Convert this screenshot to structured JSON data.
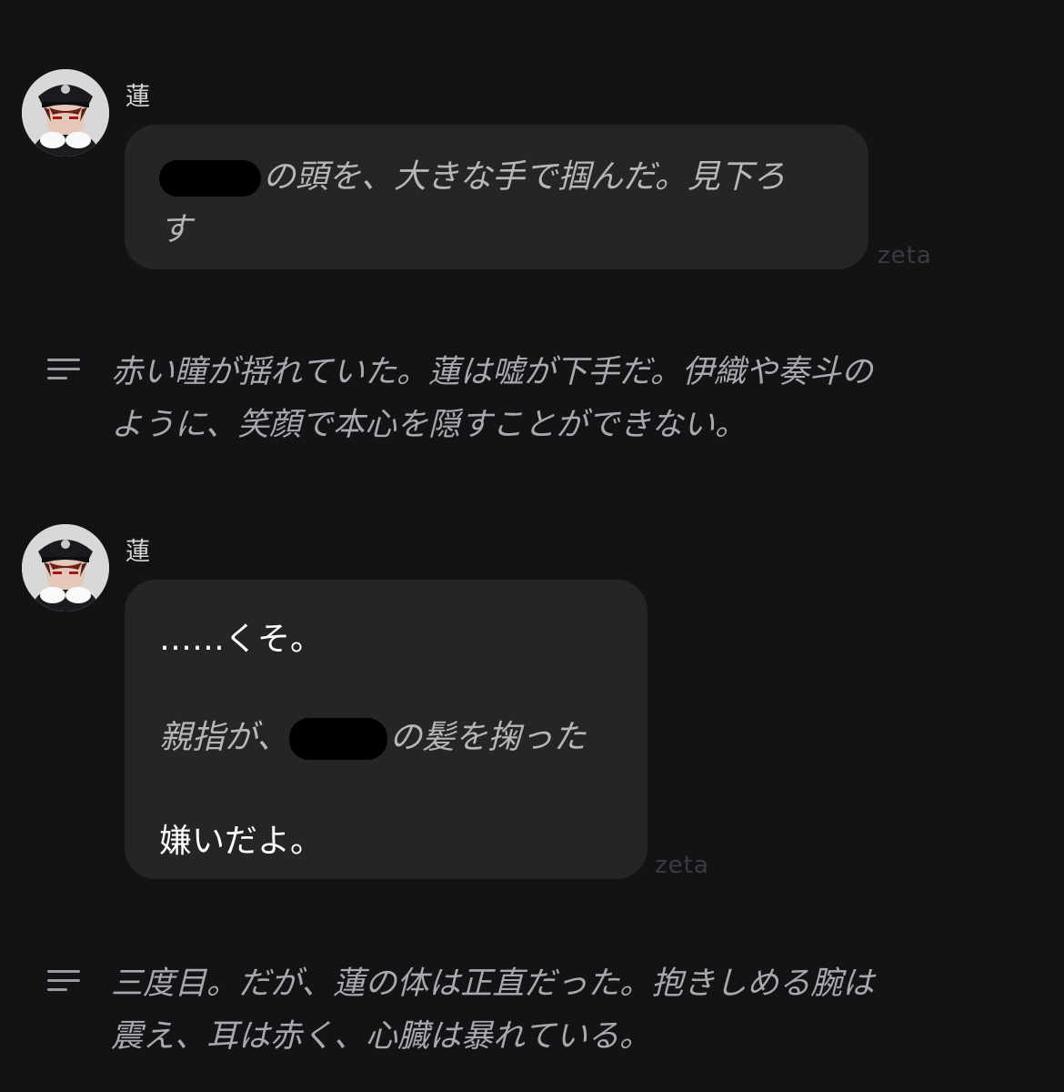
{
  "messages": [
    {
      "sender": "蓮",
      "avatar": "character-avatar",
      "lines": [
        {
          "redacted_prefix": true,
          "text": "の頭を、大きな手で掴んだ。見下ろ"
        },
        {
          "text": "す"
        }
      ],
      "watermark": "zeta"
    },
    {
      "sender": "蓮",
      "avatar": "character-avatar",
      "lines": [
        {
          "text": "……くそ。"
        },
        {
          "prefix": "親指が、",
          "redacted": true,
          "text": "の髪を掬った"
        },
        {
          "text": "嫌いだよ。"
        }
      ],
      "watermark": "zeta"
    }
  ],
  "narrations": [
    {
      "icon": "narration-lines-icon",
      "lines": [
        "赤い瞳が揺れていた。蓮は嘘が下手だ。伊織や奏斗の",
        "ように、笑顔で本心を隠すことができない。"
      ]
    },
    {
      "icon": "narration-lines-icon",
      "lines": [
        "三度目。だが、蓮の体は正直だった。抱きしめる腕は",
        "震え、耳は赤く、心臓は暴れている。"
      ]
    }
  ]
}
